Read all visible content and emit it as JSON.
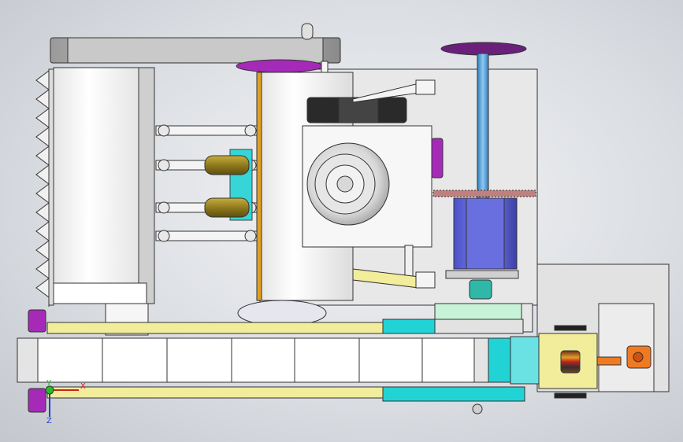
{
  "view": {
    "background": "#dcdee2",
    "triad": {
      "x_label": "X",
      "y_label": "Y",
      "z_label": "Z"
    }
  },
  "colors": {
    "frame": "#f2f2f2",
    "edge": "#333333",
    "motor": "#6a6fe0",
    "motor_dark": "#3c3fa8",
    "shaft": "#5aa3dc",
    "handwheel": "#6a1f7a",
    "cyan": "#22d3d6",
    "yellow": "#f2ed9a",
    "olive": "#8f7a1d",
    "orange": "#f07a22",
    "magenta": "#a52ab8",
    "teal": "#2fb7a8",
    "mint": "#c8f3d9"
  },
  "parts": [
    "top-beam",
    "saw-tooth-guard",
    "left-housing",
    "link-rods",
    "olive-rollers",
    "center-housing",
    "spindle-head",
    "belt-pulley",
    "handwheel",
    "lead-screw",
    "stepper-motor",
    "chain-sprocket",
    "yellow-arm",
    "base-plate",
    "conveyor-rail",
    "conveyor-frame",
    "cyan-carriage",
    "drive-box",
    "orange-bracket"
  ]
}
